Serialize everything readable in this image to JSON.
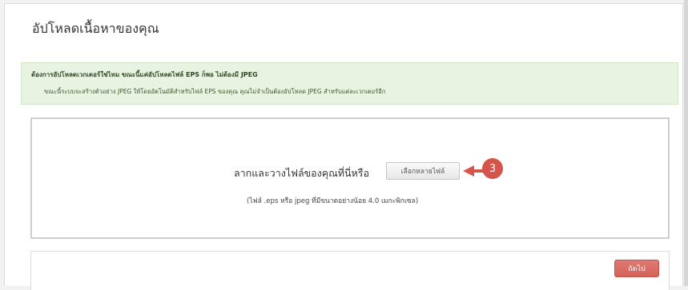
{
  "page": {
    "title": "อัปโหลดเนื้อหาของคุณ"
  },
  "notice": {
    "heading": "ต้องการอัปโหลดเวกเตอร์ใช่ไหม ขณะนี้แค่อัปโหลดไฟล์ EPS ก็พอ ไม่ต้องมี JPEG",
    "body": "ขณะนี้ระบบจะสร้างตัวอย่าง JPEG ให้โดยอัตโนมัติสำหรับไฟล์ EPS ของคุณ คุณไม่จำเป็นต้องอัปโหลด JPEG สำหรับแต่ละเวกเตอร์อีก"
  },
  "dropzone": {
    "prompt": "ลากและวางไฟล์ของคุณที่นี่หรือ",
    "choose_button": "เลือกหลายไฟล์",
    "hint": "(ไฟล์ .eps หรือ jpeg ที่มีขนาดอย่างน้อย 4.0 เมกะพิกเซล)"
  },
  "annotation": {
    "step_number": "3",
    "color": "#d5544b",
    "icon": "arrow-left-icon"
  },
  "footer": {
    "next_button": "ถัดไป",
    "next_color": "#d9675f"
  }
}
